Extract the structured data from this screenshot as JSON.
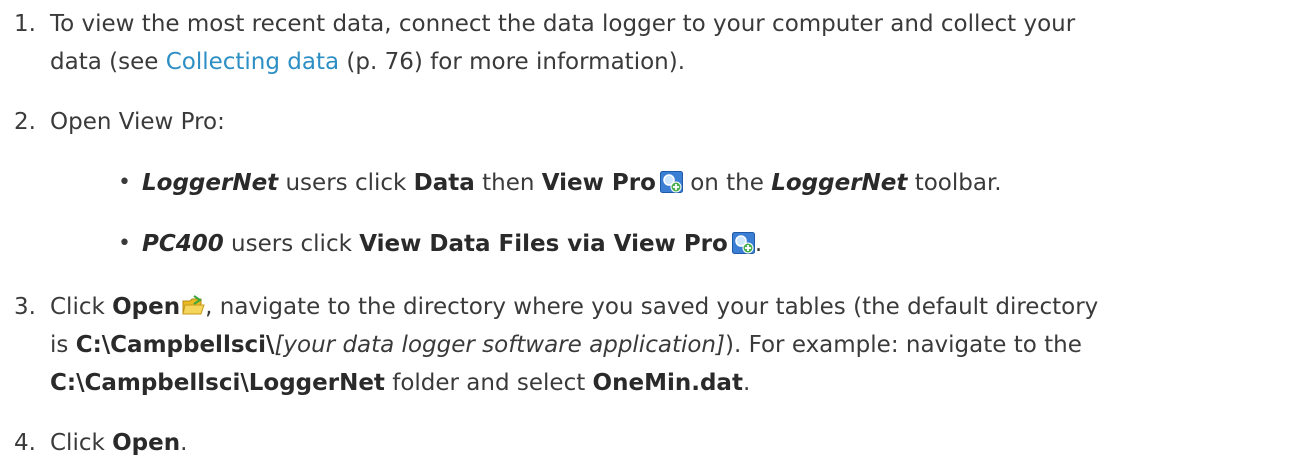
{
  "steps": [
    {
      "number": "1.",
      "line1_before": "To view the most recent data, connect the data logger to your computer and collect your",
      "line2_before": "data (see ",
      "link": "Collecting data",
      "line2_after": " (p. 76) for more information)."
    },
    {
      "number": "2.",
      "text": "Open View Pro:",
      "bullets": [
        {
          "app": "LoggerNet",
          "t1": " users click ",
          "b1": "Data",
          "t2": " then ",
          "b2": "View Pro",
          "icon": "view-pro-icon",
          "t3": " on the ",
          "app2": "LoggerNet",
          "t4": " toolbar."
        },
        {
          "app": "PC400",
          "t1": " users click ",
          "b1": "View Data Files via View Pro",
          "icon": "view-pro-icon",
          "t2": "."
        }
      ]
    },
    {
      "number": "3.",
      "t1": "Click ",
      "b1": "Open",
      "icon": "open-folder-icon",
      "t2": ", navigate to the directory where you saved your tables (the default directory",
      "t3": "is ",
      "b2": "C:\\Campbellsci\\",
      "i1": "[your data logger software application]",
      "t4": "). For example: navigate to the",
      "b3": "C:\\Campbellsci\\LoggerNet",
      "t5": " folder and select ",
      "b4": "OneMin.dat",
      "t6": "."
    },
    {
      "number": "4.",
      "t1": "Click ",
      "b1": "Open",
      "t2": "."
    }
  ],
  "colors": {
    "text": "#3a3a3a",
    "link": "#2e8fc4"
  }
}
